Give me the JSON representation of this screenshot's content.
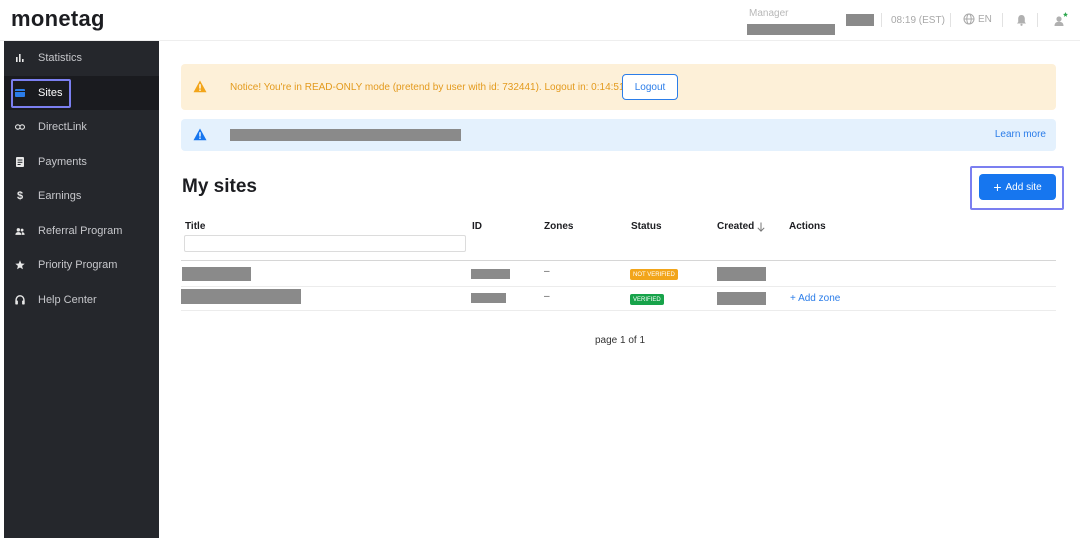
{
  "brand": {
    "logo": "monetag",
    "accent": "#2fa84f"
  },
  "header": {
    "manager_label": "Manager",
    "time": "08:19 (EST)",
    "language": "EN",
    "icons": [
      "globe-icon",
      "bell-icon",
      "user-icon"
    ]
  },
  "sidebar": {
    "items": [
      {
        "label": "Statistics",
        "icon": "bar-chart-icon"
      },
      {
        "label": "Sites",
        "icon": "sites-icon",
        "active": true
      },
      {
        "label": "DirectLink",
        "icon": "link-icon"
      },
      {
        "label": "Payments",
        "icon": "document-icon"
      },
      {
        "label": "Earnings",
        "icon": "dollar-icon"
      },
      {
        "label": "Referral Program",
        "icon": "users-icon"
      },
      {
        "label": "Priority Program",
        "icon": "star-icon"
      },
      {
        "label": "Help Center",
        "icon": "headphones-icon"
      }
    ]
  },
  "notice": {
    "text": "Notice! You're in READ-ONLY mode (pretend by user with id: 732441). Logout in: 0:14:51",
    "logout_label": "Logout"
  },
  "info": {
    "learn_more": "Learn more"
  },
  "main": {
    "title": "My sites",
    "add_site_label": "Add site",
    "columns": [
      "Title",
      "ID",
      "Zones",
      "Status",
      "Created",
      "Actions"
    ],
    "rows": [
      {
        "zones": "–",
        "status": "NOT VERIFIED",
        "action": ""
      },
      {
        "zones": "–",
        "status": "VERIFIED",
        "action": "+ Add zone"
      }
    ],
    "pagination": "page 1 of 1"
  },
  "colors": {
    "primary": "#1676ef",
    "warning": "#f2a51a",
    "success": "#17a34a",
    "sidebar_bg": "#25272c"
  }
}
